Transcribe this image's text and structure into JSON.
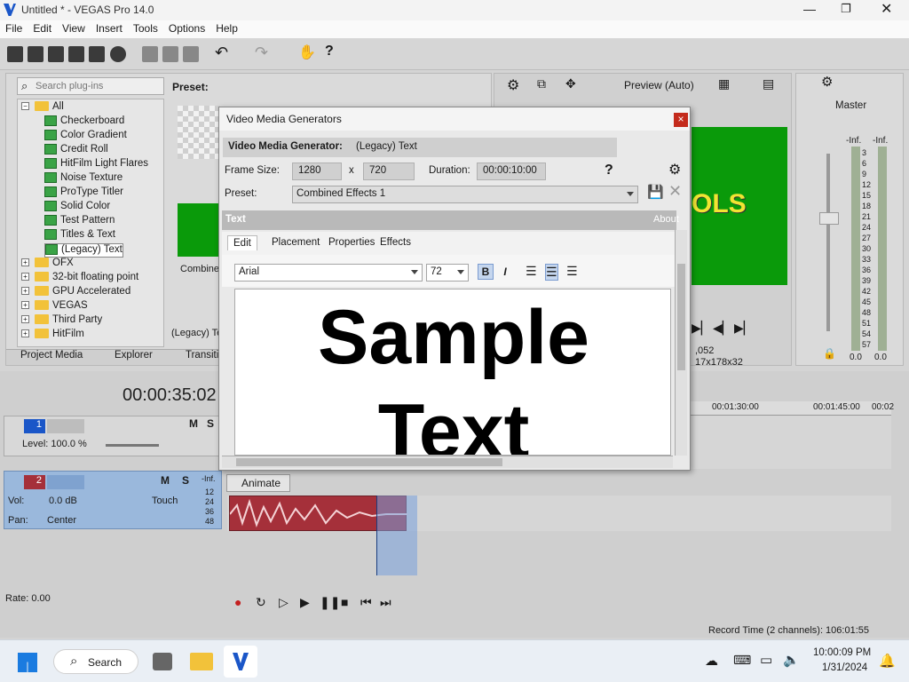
{
  "window": {
    "title": "Untitled * - VEGAS Pro 14.0"
  },
  "menu": [
    "File",
    "Edit",
    "View",
    "Insert",
    "Tools",
    "Options",
    "Help"
  ],
  "plugins": {
    "search_placeholder": "Search plug-ins",
    "preset_label": "Preset:",
    "tree": [
      {
        "label": "All",
        "type": "folder",
        "expanded": true,
        "indent": 0
      },
      {
        "label": "Checkerboard",
        "type": "plugin",
        "indent": 1
      },
      {
        "label": "Color Gradient",
        "type": "plugin",
        "indent": 1
      },
      {
        "label": "Credit Roll",
        "type": "plugin",
        "indent": 1
      },
      {
        "label": "HitFilm Light Flares",
        "type": "plugin",
        "indent": 1
      },
      {
        "label": "Noise Texture",
        "type": "plugin",
        "indent": 1
      },
      {
        "label": "ProType Titler",
        "type": "plugin",
        "indent": 1
      },
      {
        "label": "Solid Color",
        "type": "plugin",
        "indent": 1
      },
      {
        "label": "Test Pattern",
        "type": "plugin",
        "indent": 1
      },
      {
        "label": "Titles & Text",
        "type": "plugin",
        "indent": 1
      },
      {
        "label": "(Legacy) Text",
        "type": "plugin",
        "indent": 1,
        "selected": true
      },
      {
        "label": "OFX",
        "type": "folder",
        "indent": 0
      },
      {
        "label": "32-bit floating point",
        "type": "folder",
        "indent": 0
      },
      {
        "label": "GPU Accelerated",
        "type": "folder",
        "indent": 0
      },
      {
        "label": "VEGAS",
        "type": "folder",
        "indent": 0
      },
      {
        "label": "Third Party",
        "type": "folder",
        "indent": 0
      },
      {
        "label": "HitFilm",
        "type": "folder",
        "indent": 0
      }
    ],
    "preset_thumb_label": "Combine",
    "legacy_caption": "(Legacy) Te",
    "tabs": [
      "Project Media",
      "Explorer",
      "Transiti"
    ]
  },
  "preview": {
    "mode": "Preview (Auto)",
    "text_fragment": "OLS",
    "info1": ",052",
    "info2": "17x178x32"
  },
  "master": {
    "label": "Master",
    "inf_left": "-Inf.",
    "inf_right": "-Inf.",
    "scale": [
      "3",
      "6",
      "9",
      "12",
      "15",
      "18",
      "21",
      "24",
      "27",
      "30",
      "33",
      "36",
      "39",
      "42",
      "45",
      "48",
      "51",
      "54",
      "57"
    ],
    "bottom_left": "0.0",
    "bottom_right": "0.0"
  },
  "timeline": {
    "timecode": "00:00:35:02",
    "ruler": [
      "00:01:30:00",
      "00:01:45:00",
      "00:02"
    ],
    "track1": {
      "num": "1",
      "level": "Level: 100.0 %"
    },
    "track2": {
      "num": "2",
      "vol_label": "Vol:",
      "vol": "0.0 dB",
      "pan_label": "Pan:",
      "pan": "Center",
      "touch": "Touch",
      "inf": "-Inf.",
      "scale": [
        "12",
        "24",
        "36",
        "48"
      ]
    },
    "rate": "Rate: 0.00",
    "animate": "Animate",
    "record_time": "Record Time (2 channels): 106:01:55"
  },
  "dialog": {
    "title": "Video Media Generators",
    "close": "×",
    "generator_label": "Video Media Generator:",
    "generator_value": "(Legacy) Text",
    "frame_size_label": "Frame Size:",
    "width": "1280",
    "x": "x",
    "height": "720",
    "duration_label": "Duration:",
    "duration": "00:00:10:00",
    "help": "?",
    "preset_label": "Preset:",
    "preset_value": "Combined Effects 1",
    "text_header": "Text",
    "about": "About",
    "tabs": [
      "Edit",
      "Placement",
      "Properties",
      "Effects"
    ],
    "font": "Arial",
    "size": "72",
    "bold": "B",
    "italic": "I",
    "sample_line1": "Sample",
    "sample_line2": "Text"
  },
  "taskbar": {
    "search": "Search",
    "time": "10:00:09 PM",
    "date": "1/31/2024"
  },
  "colors": {
    "accent_blue": "#1a56c8",
    "green_preview": "#0a9a0a",
    "audio": "#a5303a",
    "track_sel": "#9ab8dc"
  }
}
